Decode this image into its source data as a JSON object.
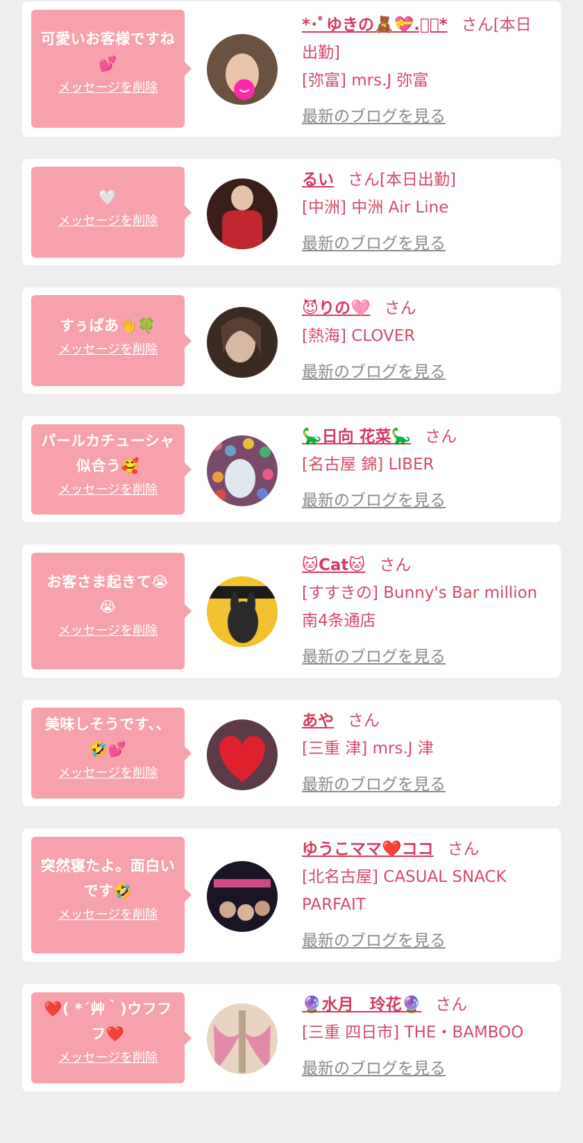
{
  "favorites": [
    {
      "message": "可愛いお客様ですね💕",
      "delete_label": "メッセージを削除",
      "cast_name": "*･ﾟゆきの🧸💝.ﾟ･*",
      "san": "さん",
      "status": "[本日出勤]",
      "area": "[弥富]",
      "shop": "mrs.J 弥富",
      "blog_label": "最新のブログを見る",
      "avatar_colors": [
        "#6b5140",
        "#e8c4a8"
      ]
    },
    {
      "message": "🤍",
      "delete_label": "メッセージを削除",
      "cast_name": "るい",
      "san": "さん",
      "status": "[本日出勤]",
      "area": "[中洲]",
      "shop": "中洲 Air Line",
      "blog_label": "最新のブログを見る",
      "avatar_colors": [
        "#3a1e1a",
        "#c0262e"
      ]
    },
    {
      "message": "すぅぱあ👋🍀",
      "delete_label": "メッセージを削除",
      "cast_name": "😈りの🩷",
      "san": "さん",
      "status": "",
      "area": "[熱海]",
      "shop": "CLOVER",
      "blog_label": "最新のブログを見る",
      "avatar_colors": [
        "#3b2a22",
        "#d7b8a0"
      ]
    },
    {
      "message": "パールカチューシャ似合う🥰",
      "delete_label": "メッセージを削除",
      "cast_name": "🦕日向 花菜🦕",
      "san": "さん",
      "status": "",
      "area": "[名古屋 錦]",
      "shop": "LIBER",
      "blog_label": "最新のブログを見る",
      "avatar_colors": [
        "#c86a8a",
        "#6aa0c8"
      ]
    },
    {
      "message": "お客さま起きて😭😭",
      "delete_label": "メッセージを削除",
      "cast_name": "🐱Cat🐱",
      "san": "さん",
      "status": "",
      "area": "[すすきの]",
      "shop": "Bunny's Bar million 南4条通店",
      "blog_label": "最新のブログを見る",
      "avatar_colors": [
        "#f2c12e",
        "#1c1c1c"
      ]
    },
    {
      "message": "美味しそうです、、🤣💕",
      "delete_label": "メッセージを削除",
      "cast_name": "あや",
      "san": "さん",
      "status": "",
      "area": "[三重 津]",
      "shop": "mrs.J 津",
      "blog_label": "最新のブログを見る",
      "avatar_colors": [
        "#5a3a46",
        "#e0202c"
      ]
    },
    {
      "message": "突然寝たよ。面白いです🤣",
      "delete_label": "メッセージを削除",
      "cast_name": "ゆうこママ❤️ココ",
      "san": "さん",
      "status": "",
      "area": "[北名古屋]",
      "shop": "CASUAL SNACK PARFAIT",
      "blog_label": "最新のブログを見る",
      "avatar_colors": [
        "#1a1424",
        "#d04a8a"
      ]
    },
    {
      "message": "❤️( *´艸｀)ウフフフ❤️",
      "delete_label": "メッセージを削除",
      "cast_name": "🔮水月　玲花🔮",
      "san": "さん",
      "status": "",
      "area": "[三重 四日市]",
      "shop": "THE・BAMBOO",
      "blog_label": "最新のブログを見る",
      "avatar_colors": [
        "#e8d4c0",
        "#e28aa8"
      ]
    }
  ]
}
